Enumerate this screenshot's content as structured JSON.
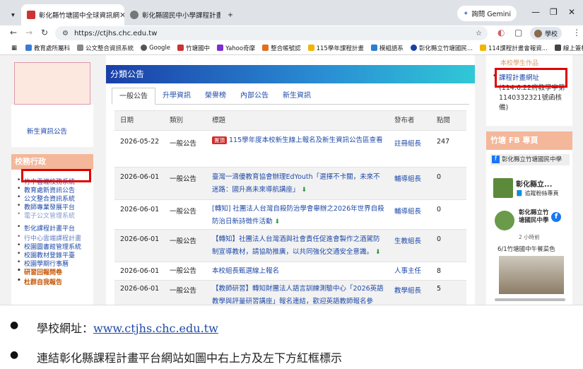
{
  "browser": {
    "tabs": [
      {
        "title": "彰化縣竹塘國中全球資訊網",
        "active": true
      },
      {
        "title": "彰化縣國民中小學課程計畫平台",
        "active": false
      }
    ],
    "new_tab": "+",
    "gemini_label": "詢問 Gemini",
    "url": "https://ctjhs.chc.edu.tw",
    "profile_label": "學校",
    "bookmarks": [
      "教育處所屬科",
      "公文整合資訊系統",
      "Google",
      "竹塘國中",
      "Yahoo奇摩",
      "整合帳號認",
      "115學年課程計畫",
      "模組語系",
      "彰化縣立竹塘國民...",
      "114課程計畫會報資...",
      "線上簽核系統"
    ]
  },
  "left": {
    "news_link": "新生資訊公告",
    "admin_title": "校務行政",
    "admin_items": [
      "竹中雲端校務系統",
      "教育處新資訊公告",
      "公文整合資訊系統",
      "教師專業發展平台",
      "電子公文管理系統",
      "彰化課程計畫平台",
      "行中心雲端課程計畫",
      "校園圖書館管理系統",
      "校園教材登錄平臺",
      "校園學期行事曆",
      "研習回報問卷",
      "杜群自我報告"
    ]
  },
  "center": {
    "section_title": "分類公告",
    "tabs": [
      "一般公告",
      "升學資訊",
      "榮譽榜",
      "內部公告",
      "新生資訊"
    ],
    "headers": {
      "date": "日期",
      "cat": "類別",
      "title": "標題",
      "pub": "發布者",
      "hits": "點閱"
    },
    "rows": [
      {
        "date": "2026-05-22",
        "cat": "一般公告",
        "badge": "置頂",
        "title": "115學年度本校新生線上報名及新生資訊公告區查看",
        "pub": "註冊組長",
        "hits": "247"
      },
      {
        "date": "2026-06-01",
        "cat": "一般公告",
        "badge": "",
        "title": "臺灣一滴優教育協會辦理EdYouth「選擇不卡關，未來不迷路：國升高未來導航講座」",
        "pub": "輔導組長",
        "hits": "0"
      },
      {
        "date": "2026-06-01",
        "cat": "一般公告",
        "badge": "",
        "title": "[轉知] 社團法人台灣自殺防治學會舉辦之2026年世界自殺防治日新詩徵件活動",
        "pub": "輔導組長",
        "hits": "0"
      },
      {
        "date": "2026-06-01",
        "cat": "一般公告",
        "badge": "",
        "title": "【轉知】社團法人台灣酒與社會責任促進會製作之酒駕防制宣導教材，請協助推廣，以共同強化交通安全意識。",
        "pub": "生教組長",
        "hits": "0"
      },
      {
        "date": "2026-06-01",
        "cat": "一般公告",
        "badge": "",
        "title": "本校組長甄選線上報名",
        "pub": "人事主任",
        "hits": "8"
      },
      {
        "date": "2026-06-01",
        "cat": "一般公告",
        "badge": "",
        "title": "【教師研習】轉知財團法人語言訓練測驗中心「2026英語教學與評量研習講座」報名連結，歡迎英語教師報名參",
        "pub": "教學組長",
        "hits": "5"
      }
    ]
  },
  "right": {
    "top_heading": "本校學生作品",
    "link": "課程計畫網址",
    "text": "(114.6.22府教學字第1140332321號函核備)",
    "fb_title": "竹塘 FB 專頁",
    "fb_page": "彰化縣立竹塘國民中學",
    "fb_name_short": "彰化縣立...",
    "fb_follow": "追蹤粉絲專頁",
    "fb_post_name": "彰化縣立竹塘國民中學",
    "fb_time": "2 小時前",
    "fb_caption": "6/1竹塘國中午餐菜色"
  },
  "notes": [
    {
      "prefix": "學校網址：",
      "link": "www.ctjhs.chc.edu.tw"
    },
    {
      "prefix": "連結彰化縣課程計畫平台網站如圖中右上方及左下方紅框標示",
      "link": ""
    }
  ],
  "colors": {
    "highlight": "#e00000",
    "header_blue": "#1a3fa8",
    "sidebar_orange": "#f4b79a",
    "link": "#1f4aa8"
  }
}
